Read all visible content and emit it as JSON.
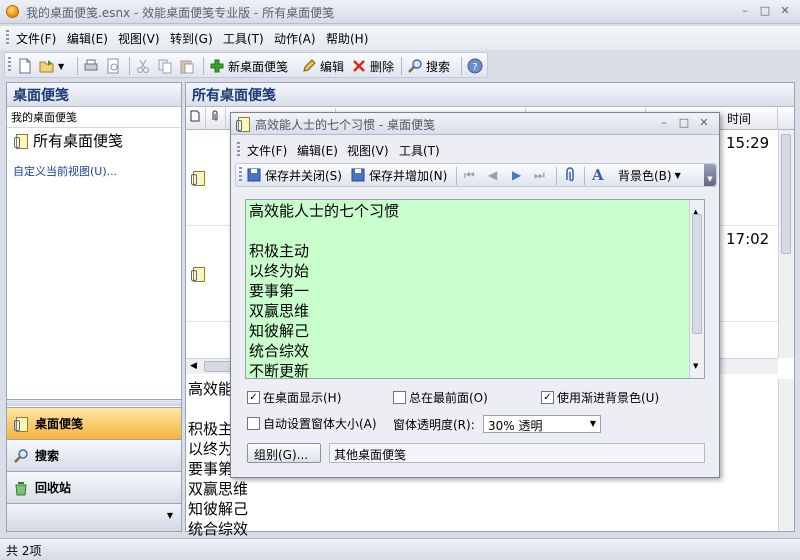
{
  "window": {
    "title": "我的桌面便笺.esnx - 效能桌面便笺专业版 - 所有桌面便笺"
  },
  "menu": [
    "文件(F)",
    "编辑(E)",
    "视图(V)",
    "转到(G)",
    "工具(T)",
    "动作(A)",
    "帮助(H)"
  ],
  "toolbar": {
    "new_note": "新桌面便笺",
    "edit": "编辑",
    "delete": "删除",
    "search": "搜索"
  },
  "nav": {
    "header": "桌面便笺",
    "group_label": "我的桌面便笺",
    "folder": "所有桌面便笺",
    "customize_link": "自定义当前视图(U)...",
    "buttons": [
      "桌面便笺",
      "搜索",
      "回收站"
    ]
  },
  "list": {
    "header": "所有桌面便笺",
    "column_time": "时间",
    "rows": [
      {
        "time": "15:29"
      },
      {
        "time": "17:02"
      }
    ],
    "preview": [
      "高效能",
      "",
      "积极主",
      "以终为",
      "要事第",
      "双赢思维",
      "知彼解己",
      "统合综效"
    ]
  },
  "status": {
    "count": "共 2项"
  },
  "note_window": {
    "title": "高效能人士的七个习惯 - 桌面便笺",
    "menu": [
      "文件(F)",
      "编辑(E)",
      "视图(V)",
      "工具(T)"
    ],
    "toolbar": {
      "save_close": "保存并关闭(S)",
      "save_add": "保存并增加(N)",
      "bgcolor": "背景色(B)"
    },
    "body_lines": [
      "高效能人士的七个习惯",
      "",
      "积极主动",
      "以终为始",
      "要事第一",
      "双赢思维",
      "知彼解己",
      "统合综效",
      "不断更新"
    ],
    "options": {
      "show_on_desktop": "在桌面显示(H)",
      "always_on_top": "总在最前面(O)",
      "gradient_bg": "使用渐进背景色(U)",
      "auto_size": "自动设置窗体大小(A)",
      "opacity_label": "窗体透明度(R):",
      "opacity_value": "30% 透明"
    },
    "group_button": "组别(G)...",
    "group_value": "其他桌面便笺"
  },
  "colors": {
    "note_bg": "#c9ffcc",
    "active_nav": "#f5b33c",
    "header_text": "#1c3a78"
  }
}
